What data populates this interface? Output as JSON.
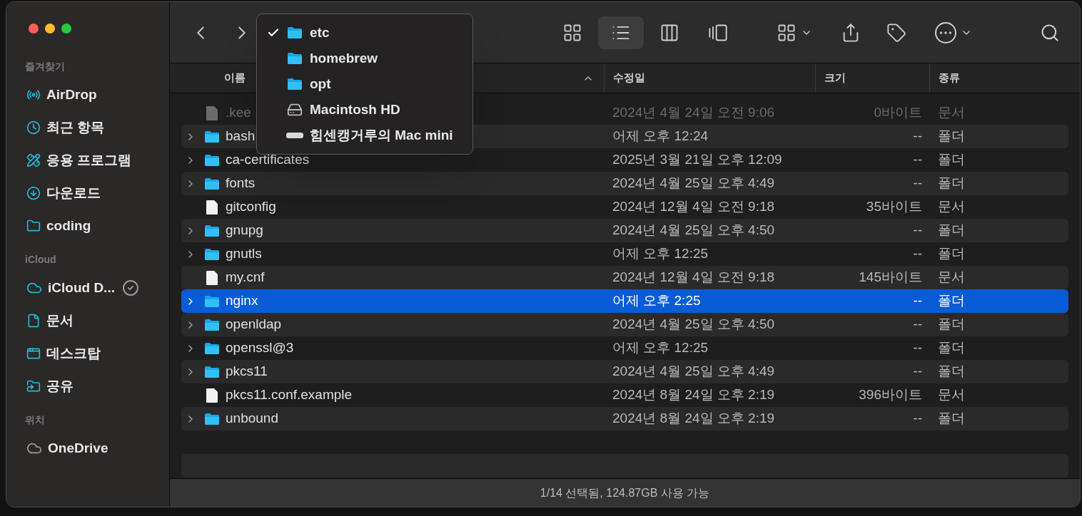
{
  "sidebar": {
    "sections": [
      {
        "title": "즐겨찾기",
        "items": [
          {
            "label": "AirDrop",
            "synced": false
          },
          {
            "label": "최근 항목",
            "synced": false
          },
          {
            "label": "응용 프로그램",
            "synced": false
          },
          {
            "label": "다운로드",
            "synced": false
          },
          {
            "label": "coding",
            "synced": false
          }
        ]
      },
      {
        "title": "iCloud",
        "items": [
          {
            "label": "iCloud D...",
            "synced": true
          },
          {
            "label": "문서",
            "synced": false
          },
          {
            "label": "데스크탑",
            "synced": false
          },
          {
            "label": "공유",
            "synced": false
          }
        ]
      },
      {
        "title": "위치",
        "items": [
          {
            "label": "OneDrive",
            "synced": false
          }
        ]
      }
    ]
  },
  "toolbar": {
    "views": [
      {
        "kind": "icons",
        "selected": false
      },
      {
        "kind": "list",
        "selected": true
      },
      {
        "kind": "columns",
        "selected": false
      },
      {
        "kind": "gallery",
        "selected": false
      }
    ]
  },
  "path_menu": [
    {
      "label": "etc",
      "kind": "folder",
      "checked": true
    },
    {
      "label": "homebrew",
      "kind": "folder",
      "checked": false
    },
    {
      "label": "opt",
      "kind": "folder",
      "checked": false
    },
    {
      "label": "Macintosh HD",
      "kind": "disk",
      "checked": false
    },
    {
      "label": "힘센캥거루의 Mac mini",
      "kind": "computer",
      "checked": false
    }
  ],
  "table": {
    "columns": [
      {
        "label": "이름",
        "sorted": true
      },
      {
        "label": "수정일",
        "sorted": false
      },
      {
        "label": "크기",
        "sorted": false
      },
      {
        "label": "종류",
        "sorted": false
      }
    ],
    "rows": [
      {
        "name": ".kee",
        "kind": "document",
        "dimmed": true,
        "expandable": false,
        "selected": false,
        "date": "2024년 4월 24일 오전 9:06",
        "size": "0바이트",
        "type": "문서"
      },
      {
        "name": "bash",
        "kind": "folder",
        "dimmed": false,
        "expandable": true,
        "selected": false,
        "date": "어제 오후 12:24",
        "size": "--",
        "type": "폴더"
      },
      {
        "name": "ca-certificates",
        "kind": "folder",
        "dimmed": false,
        "expandable": true,
        "selected": false,
        "date": "2025년 3월 21일 오후 12:09",
        "size": "--",
        "type": "폴더"
      },
      {
        "name": "fonts",
        "kind": "folder",
        "dimmed": false,
        "expandable": true,
        "selected": false,
        "date": "2024년 4월 25일 오후 4:49",
        "size": "--",
        "type": "폴더"
      },
      {
        "name": "gitconfig",
        "kind": "document",
        "dimmed": false,
        "expandable": false,
        "selected": false,
        "date": "2024년 12월 4일 오전 9:18",
        "size": "35바이트",
        "type": "문서"
      },
      {
        "name": "gnupg",
        "kind": "folder",
        "dimmed": false,
        "expandable": true,
        "selected": false,
        "date": "2024년 4월 25일 오후 4:50",
        "size": "--",
        "type": "폴더"
      },
      {
        "name": "gnutls",
        "kind": "folder",
        "dimmed": false,
        "expandable": true,
        "selected": false,
        "date": "어제 오후 12:25",
        "size": "--",
        "type": "폴더"
      },
      {
        "name": "my.cnf",
        "kind": "document",
        "dimmed": false,
        "expandable": false,
        "selected": false,
        "date": "2024년 12월 4일 오전 9:18",
        "size": "145바이트",
        "type": "문서"
      },
      {
        "name": "nginx",
        "kind": "folder",
        "dimmed": false,
        "expandable": true,
        "selected": true,
        "date": "어제 오후 2:25",
        "size": "--",
        "type": "폴더"
      },
      {
        "name": "openldap",
        "kind": "folder",
        "dimmed": false,
        "expandable": true,
        "selected": false,
        "date": "2024년 4월 25일 오후 4:50",
        "size": "--",
        "type": "폴더"
      },
      {
        "name": "openssl@3",
        "kind": "folder",
        "dimmed": false,
        "expandable": true,
        "selected": false,
        "date": "어제 오후 12:25",
        "size": "--",
        "type": "폴더"
      },
      {
        "name": "pkcs11",
        "kind": "folder",
        "dimmed": false,
        "expandable": true,
        "selected": false,
        "date": "2024년 4월 25일 오후 4:49",
        "size": "--",
        "type": "폴더"
      },
      {
        "name": "pkcs11.conf.example",
        "kind": "document",
        "dimmed": false,
        "expandable": false,
        "selected": false,
        "date": "2024년 8월 24일 오후 2:19",
        "size": "396바이트",
        "type": "문서"
      },
      {
        "name": "unbound",
        "kind": "folder",
        "dimmed": false,
        "expandable": true,
        "selected": false,
        "date": "2024년 8월 24일 오후 2:19",
        "size": "--",
        "type": "폴더"
      }
    ]
  },
  "status_bar": "1/14 선택됨, 124.87GB 사용 가능"
}
